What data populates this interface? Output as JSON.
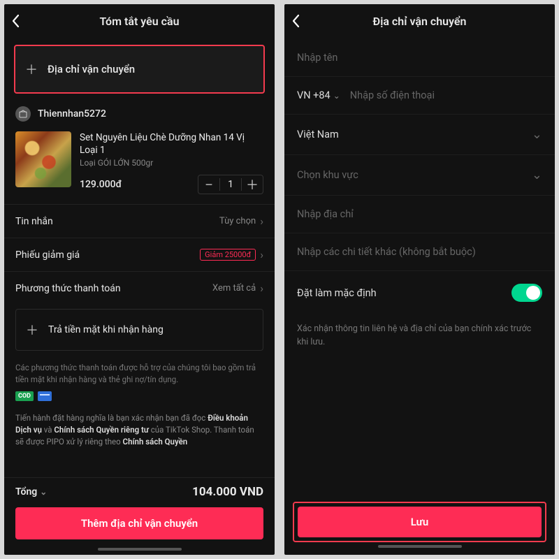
{
  "left": {
    "header_title": "Tóm tắt yêu cầu",
    "add_address_label": "Địa chỉ vận chuyển",
    "seller_name": "Thiennhan5272",
    "product": {
      "title": "Set Nguyên Liệu Chè Dưỡng Nhan 14 Vị Loại 1",
      "variant": "Loại GÓI LỚN 500gr",
      "price": "129.000đ",
      "qty": "1"
    },
    "message_row": {
      "label": "Tin nhắn",
      "right": "Tùy chọn"
    },
    "voucher_row": {
      "label": "Phiếu giảm giá",
      "badge": "Giảm 25000đ"
    },
    "payment_row": {
      "label": "Phương thức thanh toán",
      "right": "Xem tất cả"
    },
    "payment_option": "Trả tiền mặt khi nhận hàng",
    "disclaimer": "Các phương thức thanh toán được hỗ trợ của chúng tôi bao gồm trả tiền mặt khi nhận hàng và thẻ ghi nợ/tín dụng.",
    "cod_badge": "COD",
    "terms_before": "Tiến hành đặt hàng nghĩa là bạn xác nhận bạn đã đọc ",
    "terms_a1": "Điều khoản Dịch vụ",
    "terms_mid1": " và ",
    "terms_a2": "Chính sách Quyền riêng tư",
    "terms_mid2": " của TikTok Shop. Thanh toán sẽ được PIPO xử lý riêng theo ",
    "terms_a3": "Chính sách Quyền",
    "total_label": "Tổng",
    "total_value": "104.000 VND",
    "primary_btn": "Thêm địa chỉ vận chuyển"
  },
  "right": {
    "header_title": "Địa chỉ vận chuyển",
    "name_ph": "Nhập tên",
    "phone_prefix": "VN +84",
    "phone_ph": "Nhập số điện thoại",
    "country": "Việt Nam",
    "region_ph": "Chọn khu vực",
    "address_ph": "Nhập địa chỉ",
    "detail_ph": "Nhập các chi tiết khác (không bắt buộc)",
    "default_label": "Đặt làm mặc định",
    "confirm_text": "Xác nhận thông tin liên hệ và địa chỉ của bạn chính xác trước khi lưu.",
    "save_btn": "Lưu"
  }
}
